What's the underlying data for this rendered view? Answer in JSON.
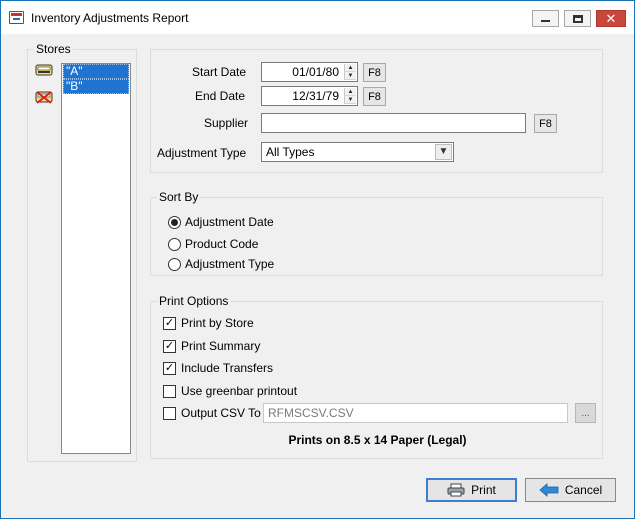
{
  "window": {
    "title": "Inventory Adjustments Report",
    "close_glyph": "✕"
  },
  "stores": {
    "label": "Stores",
    "items": [
      "\"A\"",
      "\"B\""
    ]
  },
  "filters": {
    "start_date_label": "Start Date",
    "start_date": "01/01/80",
    "end_date_label": "End Date",
    "end_date": "12/31/79",
    "supplier_label": "Supplier",
    "supplier": "",
    "f8_label": "F8",
    "adjustment_type_label": "Adjustment Type",
    "adjustment_type": "All Types"
  },
  "sort_by": {
    "label": "Sort By",
    "options": [
      "Adjustment Date",
      "Product Code",
      "Adjustment Type"
    ],
    "selected": "Adjustment Date"
  },
  "print_options": {
    "label": "Print Options",
    "print_by_store": "Print by Store",
    "print_summary": "Print Summary",
    "include_transfers": "Include Transfers",
    "use_greenbar": "Use greenbar printout",
    "output_csv": "Output CSV To",
    "csv_path": "RFMSCSV.CSV",
    "browse": "...",
    "paper_note": "Prints on 8.5 x 14 Paper (Legal)"
  },
  "buttons": {
    "print": "Print",
    "cancel": "Cancel"
  },
  "colors": {
    "selection": "#1e74d0",
    "close_button": "#c9463d",
    "default_button_border": "#3b7fd0"
  }
}
